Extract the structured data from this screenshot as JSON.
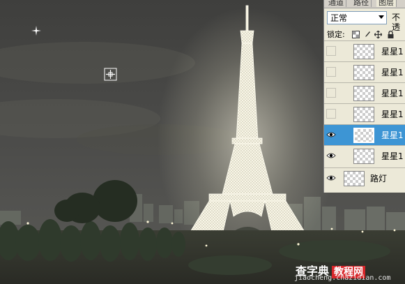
{
  "layers_panel": {
    "tabs": [
      "通道",
      "路径",
      "图层"
    ],
    "blend_mode": "正常",
    "opacity_label": "不透",
    "lock_label": "锁定:",
    "layers": [
      {
        "name": "星星1",
        "visible": false,
        "selected": false
      },
      {
        "name": "星星1",
        "visible": false,
        "selected": false
      },
      {
        "name": "星星1",
        "visible": false,
        "selected": false
      },
      {
        "name": "星星1",
        "visible": false,
        "selected": false
      },
      {
        "name": "星星1",
        "visible": true,
        "selected": true
      },
      {
        "name": "星星1",
        "visible": true,
        "selected": false
      },
      {
        "name": "路灯",
        "visible": true,
        "selected": false
      }
    ]
  },
  "watermark": {
    "main": "查字典",
    "boxed": "教程网",
    "url": "jiaocheng.chazidian.com"
  },
  "colors": {
    "sky": "#4a4a48",
    "selection": "#3d95d4",
    "panel_bg": "#ece9d8"
  }
}
